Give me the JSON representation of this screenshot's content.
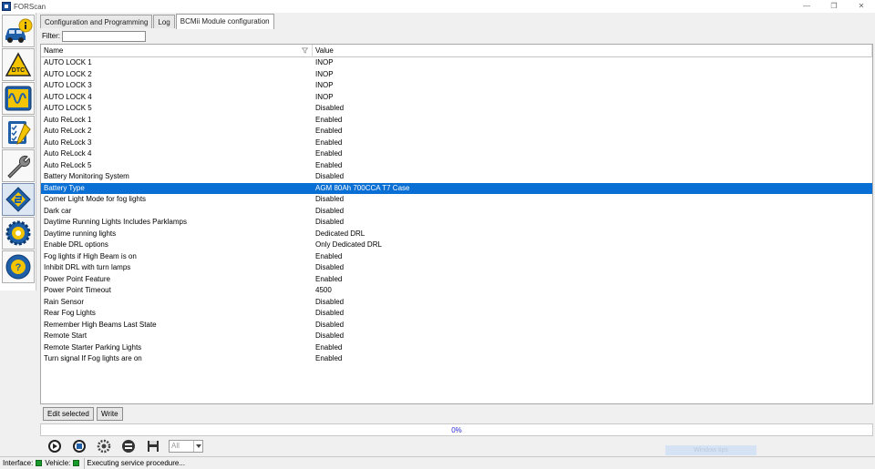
{
  "window": {
    "title": "FORScan",
    "minimize": "—",
    "restore": "❐",
    "close": "✕"
  },
  "tabs": [
    {
      "label": "Configuration and Programming",
      "active": false
    },
    {
      "label": "Log",
      "active": false
    },
    {
      "label": "BCMii Module configuration",
      "active": true
    }
  ],
  "filter": {
    "label": "Filter:",
    "value": ""
  },
  "grid": {
    "columns": {
      "name": "Name",
      "value": "Value"
    },
    "rows": [
      {
        "name": "AUTO LOCK 1",
        "value": "INOP"
      },
      {
        "name": "AUTO LOCK 2",
        "value": "INOP"
      },
      {
        "name": "AUTO LOCK 3",
        "value": "INOP"
      },
      {
        "name": "AUTO LOCK 4",
        "value": "INOP"
      },
      {
        "name": "AUTO LOCK 5",
        "value": "Disabled"
      },
      {
        "name": "Auto ReLock 1",
        "value": "Enabled"
      },
      {
        "name": "Auto ReLock 2",
        "value": "Enabled"
      },
      {
        "name": "Auto ReLock 3",
        "value": "Enabled"
      },
      {
        "name": "Auto ReLock 4",
        "value": "Enabled"
      },
      {
        "name": "Auto ReLock 5",
        "value": "Enabled"
      },
      {
        "name": "Battery Monitoring System",
        "value": "Disabled"
      },
      {
        "name": "Battery Type",
        "value": "AGM 80Ah 700CCA T7 Case",
        "selected": true
      },
      {
        "name": "Corner Light Mode for fog lights",
        "value": "Disabled"
      },
      {
        "name": "Dark car",
        "value": "Disabled"
      },
      {
        "name": "Daytime Running Lights Includes Parklamps",
        "value": "Disabled"
      },
      {
        "name": "Daytime running lights",
        "value": "Dedicated DRL"
      },
      {
        "name": "Enable DRL options",
        "value": "Only Dedicated DRL"
      },
      {
        "name": "Fog lights if High Beam is on",
        "value": "Enabled"
      },
      {
        "name": "Inhibit DRL with turn lamps",
        "value": "Disabled"
      },
      {
        "name": "Power Point Feature",
        "value": "Enabled"
      },
      {
        "name": "Power Point Timeout",
        "value": "4500"
      },
      {
        "name": "Rain Sensor",
        "value": "Disabled"
      },
      {
        "name": "Rear Fog Lights",
        "value": "Disabled"
      },
      {
        "name": "Remember High Beams Last State",
        "value": "Disabled"
      },
      {
        "name": "Remote Start",
        "value": "Disabled"
      },
      {
        "name": "Remote Starter Parking Lights",
        "value": "Enabled"
      },
      {
        "name": "Turn signal If Fog lights are on",
        "value": "Enabled"
      }
    ]
  },
  "buttons": {
    "edit_selected": "Edit selected",
    "write": "Write"
  },
  "progress": {
    "text": "0%",
    "value": 0
  },
  "toolbar": {
    "combo_value": "All",
    "ghost_button": "Window tips"
  },
  "status": {
    "interface_label": "Interface:",
    "vehicle_label": "Vehicle:",
    "message": "Executing service procedure...",
    "led_color": "#1a9a2a"
  },
  "sidebar_icons": [
    "vehicle-info-icon",
    "dtc-icon",
    "oscilloscope-icon",
    "checklist-icon",
    "wrench-icon",
    "module-chip-icon",
    "gear-icon",
    "help-wheel-icon"
  ],
  "colors": {
    "selection": "#0a6fd4",
    "progress_text": "#2b2bd8"
  }
}
